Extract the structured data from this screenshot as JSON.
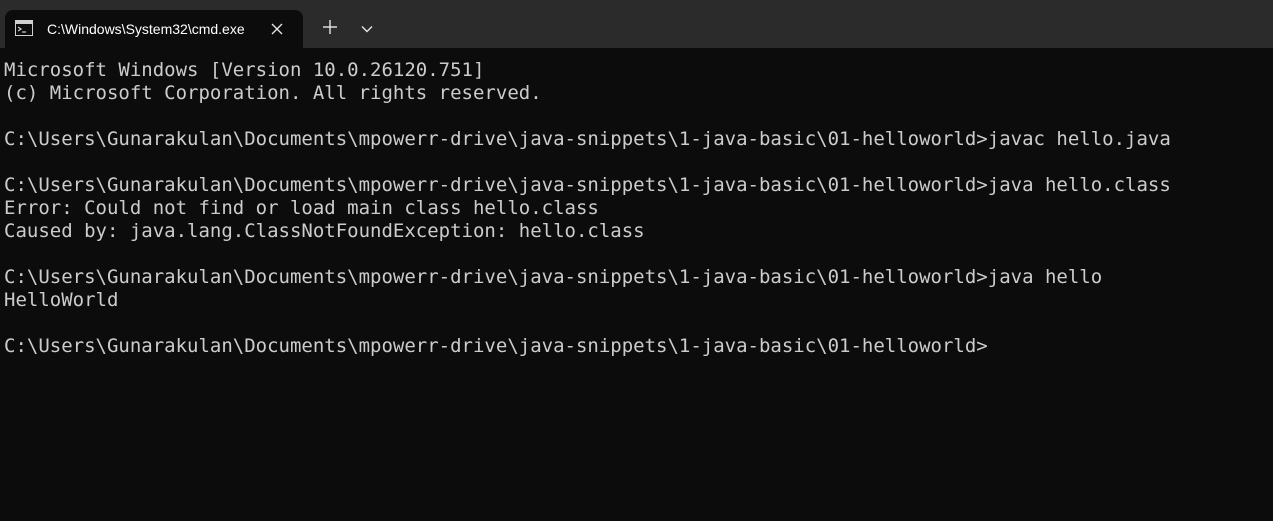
{
  "tab": {
    "title": "C:\\Windows\\System32\\cmd.exe",
    "icon": "terminal-icon",
    "close_icon": "close-icon"
  },
  "tabbar": {
    "new_tab_icon": "plus-icon",
    "dropdown_icon": "chevron-down-icon"
  },
  "colors": {
    "tabbar_bg": "#2b2b2b",
    "console_bg": "#0c0c0c",
    "text": "#cccccc",
    "tab_title": "#ffffff"
  },
  "console": {
    "lines": [
      "Microsoft Windows [Version 10.0.26120.751]",
      "(c) Microsoft Corporation. All rights reserved.",
      "",
      "C:\\Users\\Gunarakulan\\Documents\\mpowerr-drive\\java-snippets\\1-java-basic\\01-helloworld>javac hello.java",
      "",
      "C:\\Users\\Gunarakulan\\Documents\\mpowerr-drive\\java-snippets\\1-java-basic\\01-helloworld>java hello.class",
      "Error: Could not find or load main class hello.class",
      "Caused by: java.lang.ClassNotFoundException: hello.class",
      "",
      "C:\\Users\\Gunarakulan\\Documents\\mpowerr-drive\\java-snippets\\1-java-basic\\01-helloworld>java hello",
      "HelloWorld",
      "",
      "C:\\Users\\Gunarakulan\\Documents\\mpowerr-drive\\java-snippets\\1-java-basic\\01-helloworld>"
    ]
  }
}
